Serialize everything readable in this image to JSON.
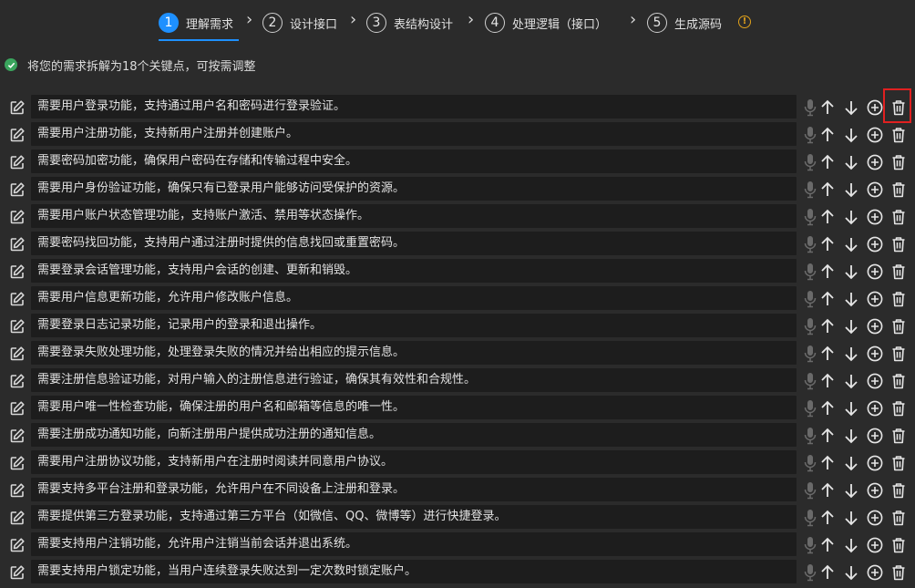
{
  "steps": [
    {
      "number": "1",
      "label": "理解需求",
      "active": true
    },
    {
      "number": "2",
      "label": "设计接口",
      "active": false
    },
    {
      "number": "3",
      "label": "表结构设计",
      "active": false
    },
    {
      "number": "4",
      "label": "处理逻辑（接口）",
      "active": false
    },
    {
      "number": "5",
      "label": "生成源码",
      "active": false
    }
  ],
  "status": {
    "text": "将您的需求拆解为18个关键点，可按需调整"
  },
  "requirements": [
    "需要用户登录功能，支持通过用户名和密码进行登录验证。",
    "需要用户注册功能，支持新用户注册并创建账户。",
    "需要密码加密功能，确保用户密码在存储和传输过程中安全。",
    "需要用户身份验证功能，确保只有已登录用户能够访问受保护的资源。",
    "需要用户账户状态管理功能，支持账户激活、禁用等状态操作。",
    "需要密码找回功能，支持用户通过注册时提供的信息找回或重置密码。",
    "需要登录会话管理功能，支持用户会话的创建、更新和销毁。",
    "需要用户信息更新功能，允许用户修改账户信息。",
    "需要登录日志记录功能，记录用户的登录和退出操作。",
    "需要登录失败处理功能，处理登录失败的情况并给出相应的提示信息。",
    "需要注册信息验证功能，对用户输入的注册信息进行验证，确保其有效性和合规性。",
    "需要用户唯一性检查功能，确保注册的用户名和邮箱等信息的唯一性。",
    "需要注册成功通知功能，向新注册用户提供成功注册的通知信息。",
    "需要用户注册协议功能，支持新用户在注册时阅读并同意用户协议。",
    "需要支持多平台注册和登录功能，允许用户在不同设备上注册和登录。",
    "需要提供第三方登录功能，支持通过第三方平台（如微信、QQ、微博等）进行快捷登录。",
    "需要支持用户注销功能，允许用户注销当前会话并退出系统。",
    "需要支持用户锁定功能，当用户连续登录失败达到一定次数时锁定账户。"
  ],
  "icons": {
    "edit": "edit-icon",
    "mic": "microphone-icon",
    "up": "arrow-up-icon",
    "down": "arrow-down-icon",
    "add": "plus-circle-icon",
    "delete": "trash-icon",
    "info": "info-icon",
    "check": "check-circle-icon"
  },
  "colors": {
    "accent": "#1e90ff",
    "success": "#3aa55d",
    "warning": "#e0a11b",
    "highlight": "#e02020"
  }
}
